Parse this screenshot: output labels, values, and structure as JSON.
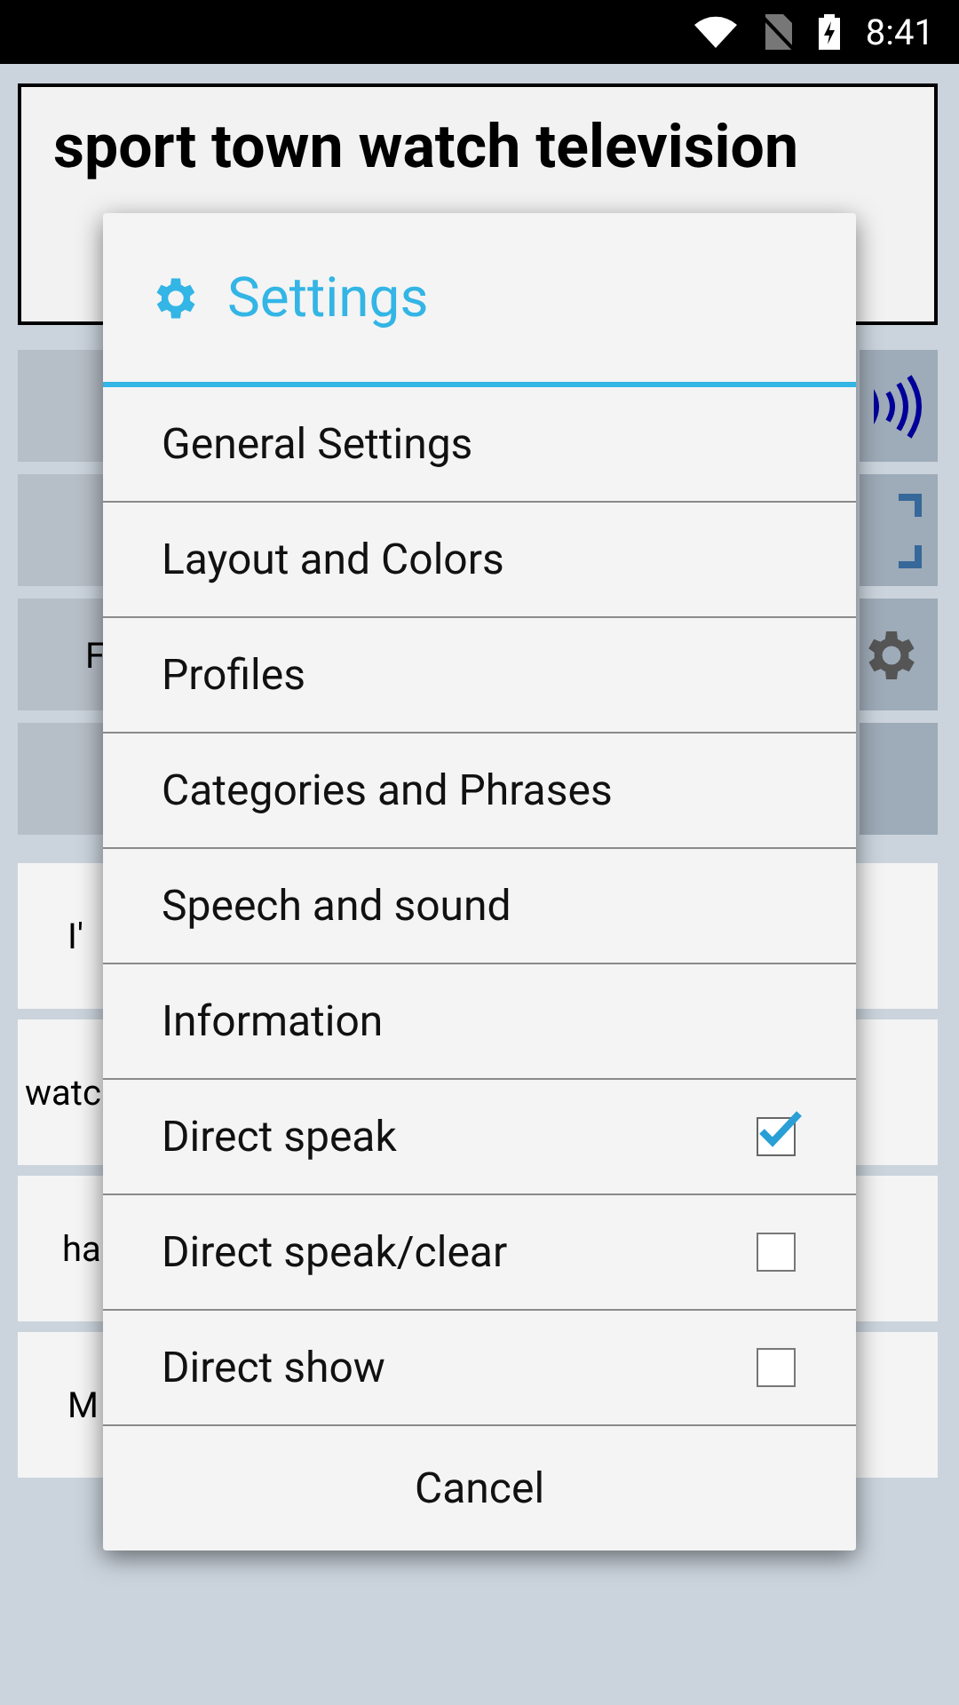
{
  "status_bar": {
    "time": "8:41"
  },
  "text_display": {
    "text": "sport town watch television"
  },
  "side_buttons": [
    {
      "kind": "category"
    },
    {
      "kind": "category"
    },
    {
      "kind": "category",
      "label": "F"
    },
    {
      "kind": "category"
    }
  ],
  "phrases": [
    {
      "text": "I'"
    },
    {
      "text": "watc"
    },
    {
      "text": "ha"
    },
    {
      "text": "M"
    }
  ],
  "dialog": {
    "title": "Settings",
    "items": [
      {
        "kind": "link",
        "label": "General Settings"
      },
      {
        "kind": "link",
        "label": "Layout and Colors"
      },
      {
        "kind": "link",
        "label": "Profiles"
      },
      {
        "kind": "link",
        "label": "Categories and Phrases"
      },
      {
        "kind": "link",
        "label": "Speech and sound"
      },
      {
        "kind": "link",
        "label": "Information"
      },
      {
        "kind": "checkbox",
        "label": "Direct speak",
        "checked": true
      },
      {
        "kind": "checkbox",
        "label": "Direct speak/clear",
        "checked": false
      },
      {
        "kind": "checkbox",
        "label": "Direct show",
        "checked": false
      }
    ],
    "cancel": "Cancel"
  }
}
